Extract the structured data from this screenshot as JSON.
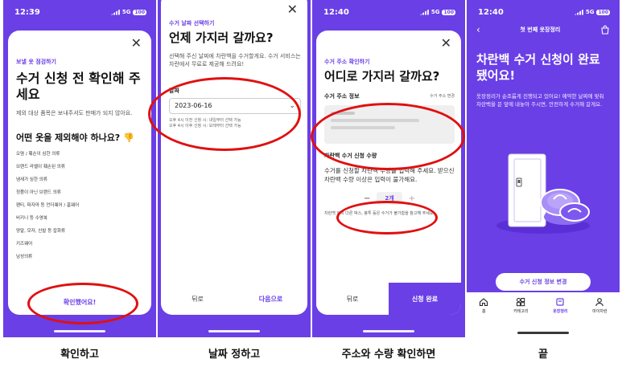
{
  "status": {
    "time1": "12:39",
    "time3": "12:40",
    "time4": "12:40",
    "network": "5G",
    "battery": "100"
  },
  "screen1": {
    "eyebrow": "보낼 옷 점검하기",
    "title": "수거 신청 전 확인해 주세요",
    "desc": "제외 대상 품목은 보내주셔도 판매가 되지 않아요.",
    "subtitle": "어떤 옷을 제외해야 하나요? 👎",
    "items": [
      "오염 / 훼손이 심한 의류",
      "브랜드 라벨이 훼손된 의류",
      "냄새가 심한 의류",
      "정품이 아닌 브랜드 의류",
      "팬티, 파자마 등 언더웨어 / 홈웨어",
      "비키니 등 수영복",
      "양말, 모자, 신발 등 잡화류",
      "키즈웨어",
      "남성의류"
    ],
    "confirm": "확인했어요!"
  },
  "screen2": {
    "eyebrow": "수거 날짜 선택하기",
    "title": "언제 가지러 갈까요?",
    "desc": "선택해 주신 날짜에 차란백을 수거할게요. 수거 서비스는 차란에서 무료로 제공해 드려요!",
    "field_label": "날짜",
    "date_value": "2023-06-16",
    "note1": "오후 4시 이전 신청 시: 내일부터 선택 가능",
    "note2": "오후 4시 이후 신청 시: 모레부터 선택 가능",
    "back": "뒤로",
    "next": "다음으로"
  },
  "screen3": {
    "eyebrow": "수거 주소 확인하기",
    "title": "어디로 가지러 갈까요?",
    "addr_label": "수거 주소 정보",
    "addr_change": "수거 주소 변경",
    "qty_label": "차란백 수거 신청 수량",
    "qty_desc": "수거를 신청할 차란백 수량을 입력해 주세요. 받으신 차란백 수량 이상은 입력이 불가해요.",
    "minus": "−",
    "qty_value": "2개",
    "plus": "+",
    "note": "차란백 외의 다른 박스, 봉투 등은 수거가 불가함을 참고해 주세요.",
    "back": "뒤로",
    "submit": "신청 완료"
  },
  "screen4": {
    "header": "첫 번째 옷장정리",
    "title": "차란백 수거 신청이 완료됐어요!",
    "desc": "옷장정리가 순조롭게 진행되고 있어요! 예약한 날짜에 맞춰 차란백을 문 앞에 내놓아 주시면, 안전하게 수거해 갈게요.",
    "change_btn": "수거 신청 정보 변경",
    "nav": [
      "홈",
      "카테고리",
      "옷장정리",
      "마이차란"
    ]
  },
  "captions": [
    "확인하고",
    "날짜 정하고",
    "주소와 수량 확인하면",
    "끝"
  ],
  "colors": {
    "brand": "#6a3fe6",
    "annotation": "#e01010"
  }
}
